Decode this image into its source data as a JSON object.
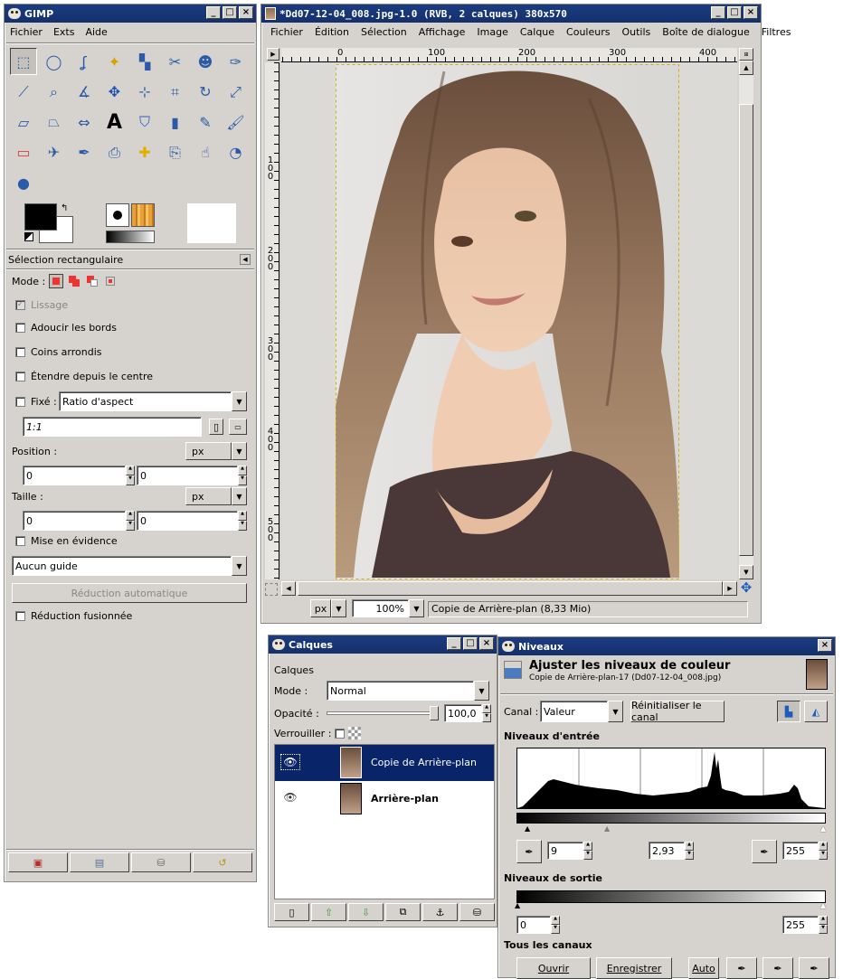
{
  "toolbox": {
    "title": "GIMP",
    "menu": [
      "Fichier",
      "Exts",
      "Aide"
    ],
    "tool_icons": [
      "rect-select",
      "ellipse-select",
      "free-select",
      "fuzzy-select",
      "select-by-color",
      "scissors",
      "foreground-select",
      "paths",
      "color-picker",
      "zoom",
      "measure",
      "move",
      "align",
      "crop",
      "rotate",
      "scale",
      "shear",
      "perspective",
      "flip",
      "text",
      "bucket-fill",
      "blend",
      "pencil",
      "paintbrush",
      "eraser",
      "airbrush",
      "ink",
      "clone",
      "heal",
      "perspective-clone",
      "smudge",
      "dodge-burn",
      "convolve"
    ],
    "options": {
      "header": "Sélection rectangulaire",
      "mode_label": "Mode :",
      "lissage": "Lissage",
      "adoucir": "Adoucir les bords",
      "coins": "Coins arrondis",
      "etendre": "Étendre depuis le centre",
      "fixe": "Fixé :",
      "fixe_value": "Ratio d'aspect",
      "ratio": "1:1",
      "position_label": "Position :",
      "position_unit": "px",
      "pos_x": "0",
      "pos_y": "0",
      "taille_label": "Taille :",
      "taille_unit": "px",
      "size_w": "0",
      "size_h": "0",
      "mise_en_evidence": "Mise en évidence",
      "guide": "Aucun guide",
      "reduction_auto": "Réduction automatique",
      "reduction_fusionnee": "Réduction fusionnée"
    }
  },
  "image_window": {
    "title": "*Dd07-12-04_008.jpg-1.0 (RVB, 2 calques) 380x570",
    "menu": [
      "Fichier",
      "Édition",
      "Sélection",
      "Affichage",
      "Image",
      "Calque",
      "Couleurs",
      "Outils",
      "Boîte de dialogue",
      "Filtres"
    ],
    "hruler": [
      "0",
      "100",
      "200",
      "300",
      "400"
    ],
    "vruler": [
      "100",
      "200",
      "300",
      "400",
      "500"
    ],
    "unit": "px",
    "zoom": "100%",
    "status": "Copie de Arrière-plan (8,33 Mio)"
  },
  "layers": {
    "title": "Calques",
    "subtitle": "Calques",
    "mode_label": "Mode :",
    "mode": "Normal",
    "opacity_label": "Opacité :",
    "opacity": "100,0",
    "lock_label": "Verrouiller :",
    "items": [
      {
        "name": "Copie de Arrière-plan",
        "selected": true
      },
      {
        "name": "Arrière-plan",
        "selected": false
      }
    ]
  },
  "levels": {
    "title": "Niveaux",
    "heading": "Ajuster les niveaux de couleur",
    "subheading": "Copie de Arrière-plan-17 (Dd07-12-04_008.jpg)",
    "canal_label": "Canal :",
    "canal": "Valeur",
    "reset": "Réinitialiser le canal",
    "input_label": "Niveaux d'entrée",
    "input_low": "9",
    "input_gamma": "2,93",
    "input_high": "255",
    "output_label": "Niveaux de sortie",
    "output_low": "0",
    "output_high": "255",
    "all_channels": "Tous les canaux",
    "open": "Ouvrir",
    "save": "Enregistrer",
    "auto": "Auto"
  },
  "colors": {
    "title_bg": "#14306b",
    "panel": "#d6d3ce",
    "selected_layer": "#0a246a"
  }
}
